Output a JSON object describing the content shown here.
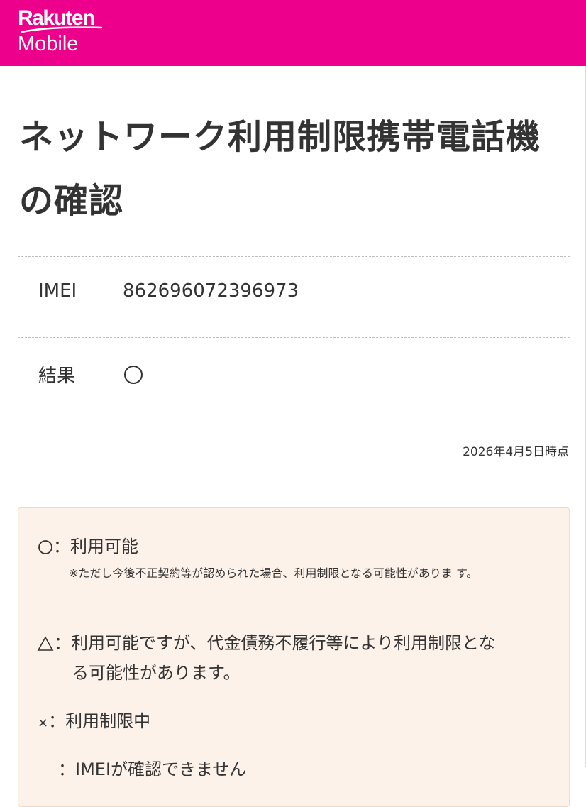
{
  "header": {
    "logo_line1": "Rakuten",
    "logo_line2": "Mobile",
    "brand_color": "#ec008c"
  },
  "page": {
    "title": "ネットワーク利用制限携帯電話機の確認"
  },
  "details": {
    "imei_label": "IMEI",
    "imei_value": "862696072396973",
    "result_label": "結果",
    "result_icon": "circle-mark",
    "timestamp": "2026年4月5日時点"
  },
  "legend": {
    "available_label": "：利用可能",
    "available_note": "※ただし今後不正契約等が認められた場合、利用制限となる可能性がありま す。",
    "triangle_line1": "：利用可能ですが、代金債務不履行等により利用制限とな",
    "triangle_line2": "る可能性があります。",
    "cross_symbol": "×",
    "cross_label": "：利用制限中",
    "unknown_label": "：IMEIが確認できません",
    "background_color": "#fdf2ea"
  }
}
